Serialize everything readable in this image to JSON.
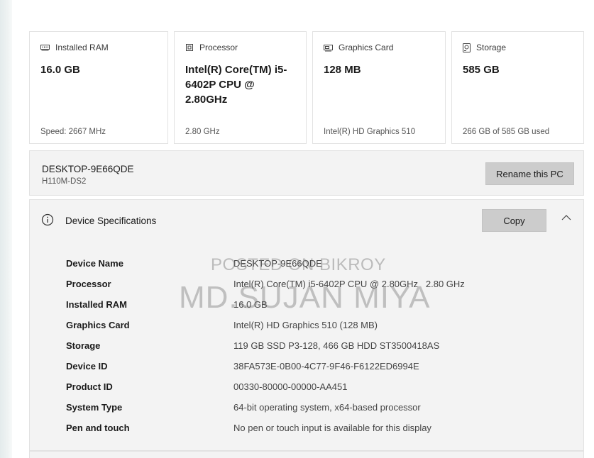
{
  "cards": [
    {
      "icon": "ram-icon",
      "title": "Installed RAM",
      "value": "16.0 GB",
      "sub": "Speed: 2667 MHz"
    },
    {
      "icon": "processor-icon",
      "title": "Processor",
      "value": "Intel(R) Core(TM) i5-6402P CPU @ 2.80GHz",
      "sub": "2.80 GHz"
    },
    {
      "icon": "graphics-card-icon",
      "title": "Graphics Card",
      "value": "128 MB",
      "sub": "Intel(R) HD Graphics 510"
    },
    {
      "icon": "storage-icon",
      "title": "Storage",
      "value": "585 GB",
      "sub": "266 GB of 585 GB used"
    }
  ],
  "pc": {
    "name": "DESKTOP-9E66QDE",
    "model": "H110M-DS2",
    "rename_label": "Rename this PC"
  },
  "specs": {
    "title": "Device Specifications",
    "copy_label": "Copy",
    "rows": [
      {
        "label": "Device Name",
        "value": "DESKTOP-9E66QDE"
      },
      {
        "label": "Processor",
        "value": "Intel(R) Core(TM) i5-6402P CPU @ 2.80GHz   2.80 GHz"
      },
      {
        "label": "Installed RAM",
        "value": "16.0 GB"
      },
      {
        "label": "Graphics Card",
        "value": "Intel(R) HD Graphics 510 (128 MB)"
      },
      {
        "label": "Storage",
        "value": "119 GB SSD P3-128, 466 GB HDD ST3500418AS"
      },
      {
        "label": "Device ID",
        "value": "38FA573E-0B00-4C77-9F46-F6122ED6994E"
      },
      {
        "label": "Product ID",
        "value": "00330-80000-00000-AA451"
      },
      {
        "label": "System Type",
        "value": "64-bit operating system, x64-based processor"
      },
      {
        "label": "Pen and touch",
        "value": "No pen or touch input is available for this display"
      }
    ]
  },
  "watermark": {
    "line1": "POSTED ON BIKROY",
    "line2": "MD.SUJAN MIYA"
  }
}
